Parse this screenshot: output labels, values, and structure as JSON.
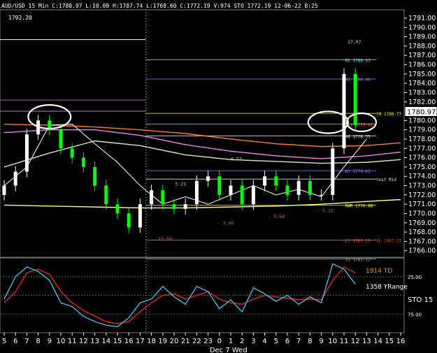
{
  "header": {
    "text": "AUD/USD 15 Min C:1780.97 L:10.09 H:1787.74 L:1768.60 C:1772.19 V:974 STO 1772.19 12-06-22 8:25",
    "y_high_label": "1792.20"
  },
  "colors": {
    "background": "#000000",
    "up_candle": "#ffffff",
    "down_candle": "#00ff00",
    "grid": "#9aa29a",
    "slow_ma": "#ffff66",
    "mid_ma": "#ff8c00",
    "orange_ma": "#ff7f24",
    "violet_ma": "#ee82ee",
    "white_ma": "#ffffff",
    "stoch_k": "#33ccff",
    "stoch_d": "#cc2222",
    "level_cyan": "#7fe5e5",
    "level_violet": "#9b7dff",
    "level_red": "#ff4d4d",
    "level_yellow": "#ffff00",
    "annot_red": "#ff5050",
    "annot_green": "#7fff7f"
  },
  "chart_data": [
    {
      "type": "candlestick",
      "title": "AUD/USD 15 Min",
      "ylim": [
        1765.3,
        1791.9
      ],
      "y_ticks": [
        1766,
        1767,
        1768,
        1769,
        1770,
        1771,
        1772,
        1773,
        1774,
        1775,
        1776,
        1777,
        1778,
        1779,
        1780,
        1781,
        1782,
        1783,
        1784,
        1785,
        1786,
        1787,
        1788,
        1789,
        1790,
        1791
      ],
      "last_price_label": "1780.97",
      "x_ticks": [
        "5",
        "6",
        "7",
        "8",
        "9",
        "10",
        "11",
        "12",
        "13",
        "14",
        "15",
        "16",
        "17",
        "18",
        "19",
        "20",
        "21",
        "22",
        "23",
        "0",
        "1",
        "2",
        "3",
        "4",
        "5",
        "6",
        "7",
        "8",
        "9",
        "10",
        "11",
        "12",
        "13",
        "14",
        "15",
        "16"
      ],
      "date_label": "Dec 7 Wed",
      "levels": [
        {
          "label": "R2 1786.53",
          "value": 1786.53,
          "color": "#7fe5e5"
        },
        {
          "label": "H5 1784.46",
          "value": 1784.46,
          "color": "#9b7dff"
        },
        {
          "label": "YH 1780.77",
          "value": 1780.77,
          "color": "#ffff00"
        },
        {
          "label": "HL3 1779.62",
          "value": 1779.62,
          "color": "#ff8c00"
        },
        {
          "label": "H4 1778.35",
          "value": 1778.35,
          "color": "#dddddd"
        },
        {
          "label": "H3 1774.61",
          "value": 1774.61,
          "color": "#9b7dff"
        },
        {
          "label": "Yest Mid",
          "value": 1773.7,
          "color": "#dddddd"
        },
        {
          "label": "RWR 1770.88",
          "value": 1770.88,
          "color": "#ffff00"
        },
        {
          "label": "L3 1767.15",
          "value": 1767.15,
          "color": "#ff4d4d"
        },
        {
          "label": "YL 1767.15",
          "value": 1767.15,
          "color": "#ff4d4d"
        },
        {
          "label": "S1 1765.12",
          "value": 1765.12,
          "color": "#9aa29a"
        }
      ],
      "annotations": [
        {
          "text": "- 13.59",
          "x": 13.6,
          "y": 1767.1,
          "color": "#ff5050"
        },
        {
          "text": "5.21",
          "x": 15.6,
          "y": 1773.0,
          "color": "#7fff7f"
        },
        {
          "text": "- 3.00",
          "x": 19.3,
          "y": 1768.8,
          "color": "#ff5050"
        },
        {
          "text": "6.53",
          "x": 20.5,
          "y": 1775.7,
          "color": "#7fff7f"
        },
        {
          "text": "- 5.54",
          "x": 23.8,
          "y": 1769.5,
          "color": "#ff5050"
        },
        {
          "text": "- 5.15",
          "x": 28.1,
          "y": 1770.1,
          "color": "#ff5050"
        },
        {
          "text": "17.07",
          "x": 30.8,
          "y": 1788.3,
          "color": "#7fff7f"
        }
      ],
      "series": [
        {
          "name": "slow_ma",
          "x": [
            0,
            4,
            8,
            12,
            16,
            20,
            24,
            28,
            32,
            35
          ],
          "values": [
            1770.9,
            1770.8,
            1770.7,
            1770.6,
            1770.6,
            1770.7,
            1770.8,
            1771.0,
            1771.3,
            1771.5
          ]
        },
        {
          "name": "mid_ma",
          "x": [
            0,
            4,
            8,
            12,
            16,
            20,
            24,
            28,
            32,
            35
          ],
          "values": [
            1779.6,
            1779.5,
            1779.3,
            1779.0,
            1778.6,
            1778.0,
            1777.5,
            1777.2,
            1777.3,
            1777.6
          ]
        },
        {
          "name": "violet_ma",
          "x": [
            0,
            4,
            8,
            12,
            16,
            20,
            24,
            28,
            32,
            35
          ],
          "values": [
            1778.7,
            1779.0,
            1779.0,
            1778.4,
            1777.4,
            1776.7,
            1776.2,
            1775.9,
            1776.2,
            1776.6
          ]
        },
        {
          "name": "white_ma",
          "x": [
            0,
            4,
            8,
            12,
            16,
            20,
            24,
            28,
            32,
            35
          ],
          "values": [
            1775.0,
            1776.5,
            1777.8,
            1777.3,
            1776.3,
            1775.8,
            1775.6,
            1775.4,
            1775.5,
            1775.8
          ]
        },
        {
          "name": "fast_ma",
          "x": [
            0,
            2,
            4,
            6,
            8,
            10,
            12,
            14,
            16,
            18,
            20,
            22,
            24,
            26,
            28,
            30,
            32
          ],
          "values": [
            1773,
            1775,
            1779.5,
            1779.6,
            1777.5,
            1775.5,
            1773,
            1771,
            1771.8,
            1771,
            1772,
            1773,
            1772,
            1772.6,
            1771.8,
            1775,
            1778
          ]
        },
        {
          "name": "candles_close",
          "x": [
            0,
            1,
            2,
            3,
            4,
            5,
            6,
            7,
            8,
            9,
            10,
            11,
            12,
            13,
            14,
            15,
            16,
            17,
            18,
            19,
            20,
            21,
            22,
            23,
            24,
            25,
            26,
            27,
            28,
            29,
            30,
            31
          ],
          "values": [
            1773,
            1774.5,
            1778.5,
            1780,
            1779,
            1777,
            1776,
            1775,
            1773,
            1771,
            1770,
            1768.5,
            1771,
            1772.5,
            1771,
            1770.5,
            1771,
            1773.5,
            1774,
            1772,
            1773,
            1771,
            1773,
            1774,
            1773,
            1772,
            1773.5,
            1772,
            1772,
            1777,
            1785,
            1779.5
          ]
        }
      ]
    },
    {
      "type": "line",
      "title": "STO",
      "indicator_labels": [
        "1914 TD",
        "1358 YRange",
        "STO 15"
      ],
      "y_ticks": [
        {
          "label": "25.00",
          "value": 75
        },
        {
          "label": "75.00",
          "value": 25
        }
      ],
      "ylim": [
        0,
        100
      ],
      "series": [
        {
          "name": "%K",
          "x": [
            0,
            1,
            2,
            3,
            4,
            5,
            6,
            7,
            8,
            9,
            10,
            11,
            12,
            13,
            14,
            15,
            16,
            17,
            18,
            19,
            20,
            21,
            22,
            23,
            24,
            25,
            26,
            27,
            28,
            29,
            30,
            31
          ],
          "values": [
            45,
            75,
            88,
            82,
            70,
            40,
            35,
            22,
            15,
            10,
            8,
            20,
            40,
            45,
            62,
            48,
            38,
            62,
            55,
            32,
            44,
            28,
            60,
            52,
            42,
            50,
            38,
            48,
            40,
            92,
            85,
            65
          ]
        },
        {
          "name": "%D",
          "x": [
            0,
            1,
            2,
            3,
            4,
            5,
            6,
            7,
            8,
            9,
            10,
            11,
            12,
            13,
            14,
            15,
            16,
            17,
            18,
            19,
            20,
            21,
            22,
            23,
            24,
            25,
            26,
            27,
            28,
            29,
            30,
            31
          ],
          "values": [
            40,
            55,
            80,
            85,
            78,
            55,
            40,
            30,
            22,
            15,
            12,
            15,
            28,
            40,
            50,
            52,
            45,
            50,
            55,
            45,
            40,
            38,
            45,
            50,
            48,
            46,
            44,
            45,
            44,
            70,
            88,
            80
          ]
        }
      ]
    }
  ]
}
